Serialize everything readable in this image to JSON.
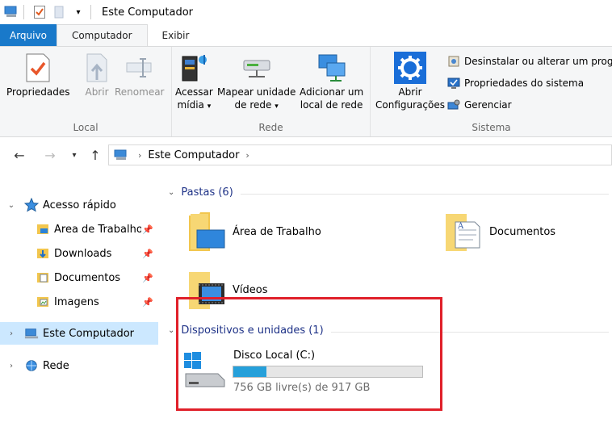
{
  "window": {
    "title": "Este Computador"
  },
  "tabs": [
    {
      "label": "Arquivo"
    },
    {
      "label": "Computador"
    },
    {
      "label": "Exibir"
    }
  ],
  "ribbon": {
    "local": {
      "label": "Local",
      "propriedades": "Propriedades",
      "abrir": "Abrir",
      "renomear": "Renomear"
    },
    "rede": {
      "label": "Rede",
      "acessar_line1": "Acessar",
      "acessar_line2": "mídia",
      "mapear_line1": "Mapear unidade",
      "mapear_line2": "de rede",
      "adicionar_line1": "Adicionar um",
      "adicionar_line2": "local de rede"
    },
    "sistema": {
      "label": "Sistema",
      "abrir_config_line1": "Abrir",
      "abrir_config_line2": "Configurações",
      "desinstalar": "Desinstalar ou alterar um prog",
      "propriedades_sistema": "Propriedades do sistema",
      "gerenciar": "Gerenciar"
    },
    "dropdown_arrow": "▾"
  },
  "address": {
    "crumb": "Este Computador",
    "sep": "›"
  },
  "nav": {
    "acesso_rapido": "Acesso rápido",
    "area_trabalho": "Área de Trabalho",
    "downloads": "Downloads",
    "documentos": "Documentos",
    "imagens": "Imagens",
    "este_computador": "Este Computador",
    "rede": "Rede"
  },
  "content": {
    "pastas_header": "Pastas (6)",
    "folders": [
      {
        "name": "Área de Trabalho"
      },
      {
        "name": "Documentos"
      },
      {
        "name": "Vídeos"
      }
    ],
    "devices_header": "Dispositivos e unidades (1)",
    "drive": {
      "name": "Disco Local (C:)",
      "free_text": "756 GB livre(s) de 917 GB",
      "used_fraction": 0.176
    }
  },
  "colors": {
    "accent": "#1979ca",
    "selected_bg": "#cce8ff",
    "drive_fill": "#26a0da",
    "highlight": "#e0202a",
    "section_text": "#1e3287"
  }
}
